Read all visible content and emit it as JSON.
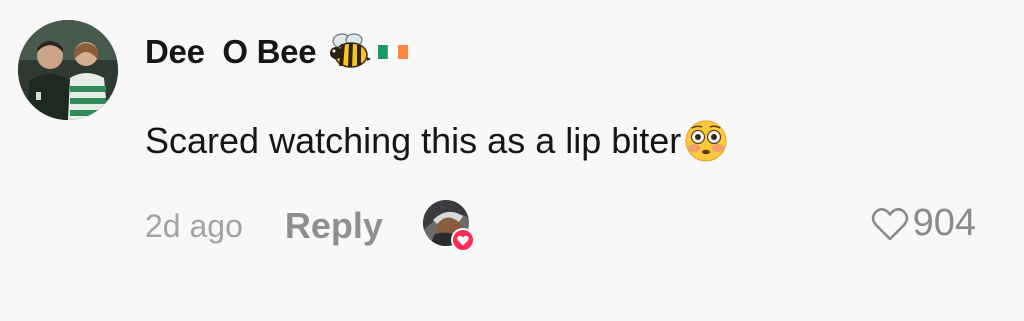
{
  "comment": {
    "username": "Dee  O Bee",
    "username_emojis": [
      "bee-icon",
      "ireland-flag-icon"
    ],
    "text": "Scared watching this as a lip biter",
    "text_emoji": "flushed-face-icon",
    "timestamp": "2d ago",
    "reply_label": "Reply",
    "creator_liked": true,
    "like_count": "904"
  },
  "colors": {
    "background": "#f8f8f8",
    "username": "#161616",
    "text": "#161616",
    "meta_gray": "#a3a3a3",
    "reply_gray": "#8f8f8f",
    "like_gray": "#8a8a8a",
    "creator_heart": "#fe2c55",
    "flag_green": "#169b62",
    "flag_orange": "#ff883e"
  }
}
